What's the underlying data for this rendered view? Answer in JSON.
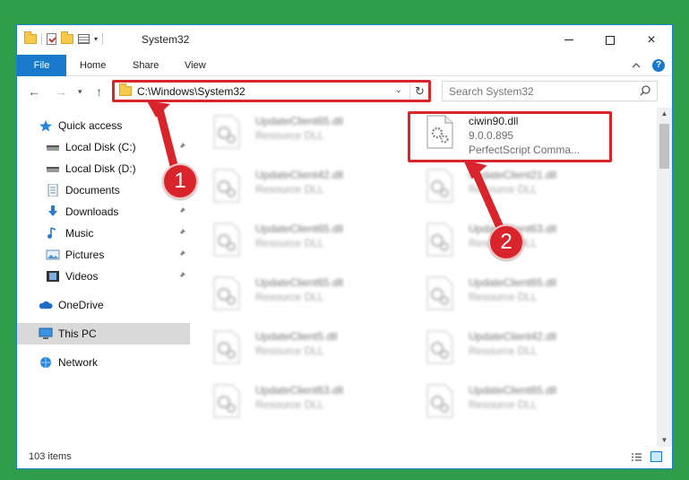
{
  "window": {
    "title": "System32",
    "controls": {
      "minimize": "minimize",
      "maximize": "maximize",
      "close": "×"
    }
  },
  "ribbon": {
    "tabs": [
      "File",
      "Home",
      "Share",
      "View"
    ],
    "help": "?"
  },
  "address": {
    "path": "C:\\Windows\\System32",
    "search_placeholder": "Search System32"
  },
  "sidebar": {
    "items": [
      {
        "label": "Quick access",
        "icon": "star-icon"
      },
      {
        "label": "Local Disk (C:)",
        "icon": "drive-icon"
      },
      {
        "label": "Local Disk (D:)",
        "icon": "drive-icon"
      },
      {
        "label": "Documents",
        "icon": "documents-icon"
      },
      {
        "label": "Downloads",
        "icon": "download-icon"
      },
      {
        "label": "Music",
        "icon": "music-icon"
      },
      {
        "label": "Pictures",
        "icon": "pictures-icon"
      },
      {
        "label": "Videos",
        "icon": "video-icon"
      },
      {
        "label": "OneDrive",
        "icon": "cloud-icon"
      },
      {
        "label": "This PC",
        "icon": "computer-icon"
      },
      {
        "label": "Network",
        "icon": "network-icon"
      }
    ]
  },
  "files": {
    "highlight": {
      "name": "ciwin90.dll",
      "version": "9.0.0.895",
      "description": "PerfectScript Comma..."
    },
    "left": [
      {
        "name": "UpdateClient65.dll",
        "type": "Resource DLL"
      },
      {
        "name": "UpdateClient42.dll",
        "type": "Resource DLL"
      },
      {
        "name": "UpdateClient65.dll",
        "type": "Resource DLL"
      },
      {
        "name": "UpdateClient65.dll",
        "type": "Resource DLL"
      },
      {
        "name": "UpdateClient5.dll",
        "type": "Resource DLL"
      },
      {
        "name": "UpdateClient63.dll",
        "type": "Resource DLL"
      }
    ],
    "right": [
      {
        "name": "UpdateClient21.dll",
        "type": "Resource DLL"
      },
      {
        "name": "UpdateClient63.dll",
        "type": "Resource DLL"
      },
      {
        "name": "UpdateClient65.dll",
        "type": "Resource DLL"
      },
      {
        "name": "UpdateClient42.dll",
        "type": "Resource DLL"
      },
      {
        "name": "UpdateClient65.dll",
        "type": "Resource DLL"
      }
    ]
  },
  "status": {
    "item_count": "103 items"
  },
  "callouts": [
    "1",
    "2"
  ],
  "colors": {
    "accent": "#1979ca",
    "highlight_red": "#d9242b",
    "background_green": "#2f9e4c"
  }
}
